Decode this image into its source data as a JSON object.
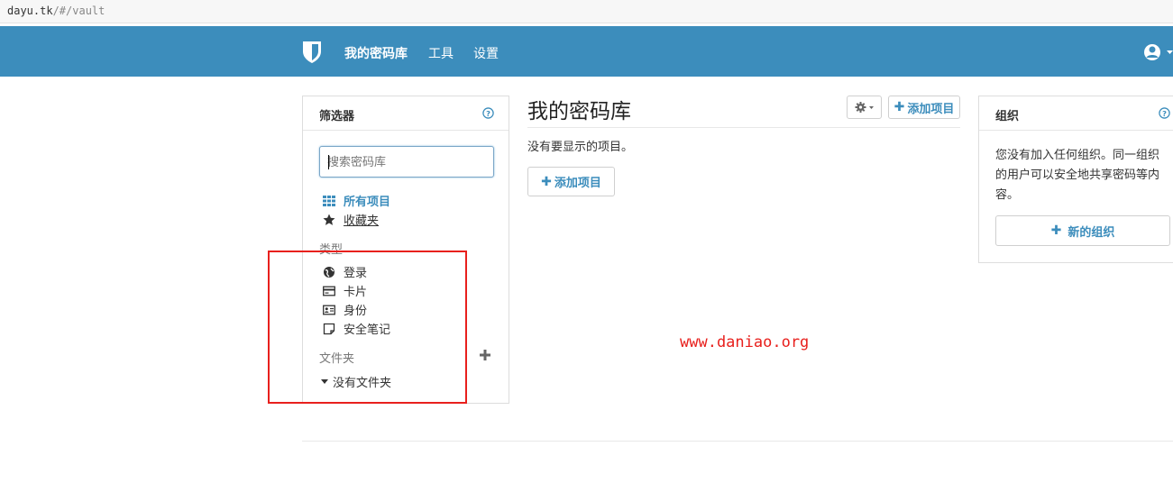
{
  "browser": {
    "url_host": "dayu.tk",
    "url_path": "/#/vault"
  },
  "navbar": {
    "items": [
      {
        "label": "我的密码库",
        "active": true
      },
      {
        "label": "工具",
        "active": false
      },
      {
        "label": "设置",
        "active": false
      }
    ],
    "icons": {
      "logo": "shield-icon",
      "user": "user-circle-icon"
    },
    "background": "#3c8dbc"
  },
  "filter": {
    "title": "筛选器",
    "search_placeholder": "搜索密码库",
    "all_items": "所有项目",
    "favorites": "收藏夹",
    "types_label": "类型",
    "types": [
      {
        "label": "登录",
        "icon": "globe-icon"
      },
      {
        "label": "卡片",
        "icon": "credit-card-icon"
      },
      {
        "label": "身份",
        "icon": "id-card-icon"
      },
      {
        "label": "安全笔记",
        "icon": "sticky-note-icon"
      }
    ],
    "folders_label": "文件夹",
    "no_folder": "没有文件夹"
  },
  "main": {
    "title": "我的密码库",
    "add_item": "添加项目",
    "empty_message": "没有要显示的项目。"
  },
  "organizations": {
    "title": "组织",
    "description": "您没有加入任何组织。同一组织的用户可以安全地共享密码等内容。",
    "new_org": "新的组织"
  },
  "watermark": "www.daniao.org",
  "colors": {
    "accent": "#3c8dbc",
    "highlight_box": "#e8201d"
  }
}
